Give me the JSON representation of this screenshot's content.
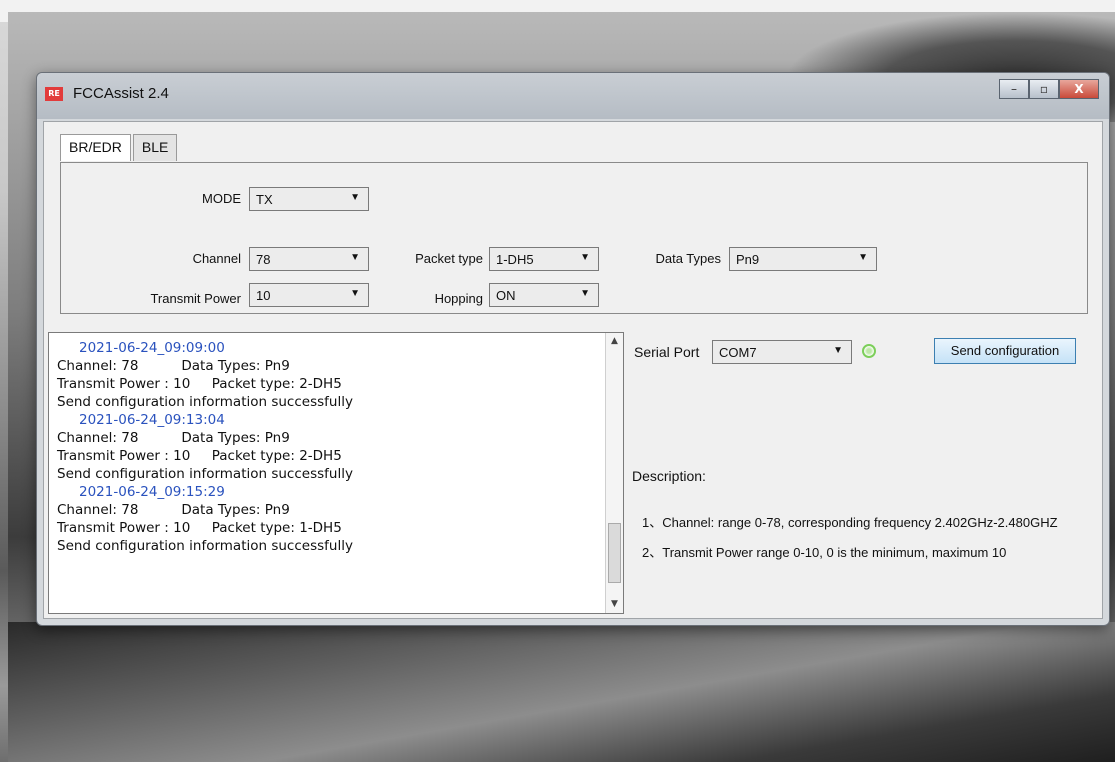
{
  "window": {
    "title": "FCCAssist 2.4",
    "icon_text": "RE",
    "controls": {
      "minimize": "–",
      "maximize": "▫",
      "close": "X"
    }
  },
  "tabs": [
    {
      "label": "BR/EDR",
      "active": true
    },
    {
      "label": "BLE",
      "active": false
    }
  ],
  "settings": {
    "mode": {
      "label": "MODE",
      "value": "TX"
    },
    "channel": {
      "label": "Channel",
      "value": "78"
    },
    "transmit_power": {
      "label": "Transmit Power",
      "value": "10"
    },
    "packet_type": {
      "label": "Packet type",
      "value": "1-DH5"
    },
    "hopping": {
      "label": "Hopping",
      "value": "ON"
    },
    "data_types": {
      "label": "Data Types",
      "value": "Pn9"
    }
  },
  "log": {
    "entries": [
      {
        "timestamp": "2021-06-24_09:09:00",
        "line1": "Channel: 78          Data Types: Pn9",
        "line2": "Transmit Power : 10     Packet type: 2-DH5",
        "line3": "Send configuration information successfully"
      },
      {
        "timestamp": "2021-06-24_09:13:04",
        "line1": "Channel: 78          Data Types: Pn9",
        "line2": "Transmit Power : 10     Packet type: 2-DH5",
        "line3": "Send configuration information successfully"
      },
      {
        "timestamp": "2021-06-24_09:15:29",
        "line1": "Channel: 78          Data Types: Pn9",
        "line2": "Transmit Power : 10     Packet type: 1-DH5",
        "line3": "Send configuration information successfully"
      }
    ],
    "scroll": {
      "up": "▲",
      "down": "▼"
    }
  },
  "serial": {
    "label": "Serial Port",
    "value": "COM7",
    "status_color": "#7ccf5a",
    "send_button": "Send configuration"
  },
  "description": {
    "title": "Description:",
    "items": [
      "1、Channel: range 0-78, corresponding frequency 2.402GHz-2.480GHZ",
      "2、Transmit Power  range 0-10, 0 is the minimum, maximum 10"
    ]
  },
  "colors": {
    "timestamp": "#2a52be",
    "send_button_border": "#3c7fb1"
  }
}
